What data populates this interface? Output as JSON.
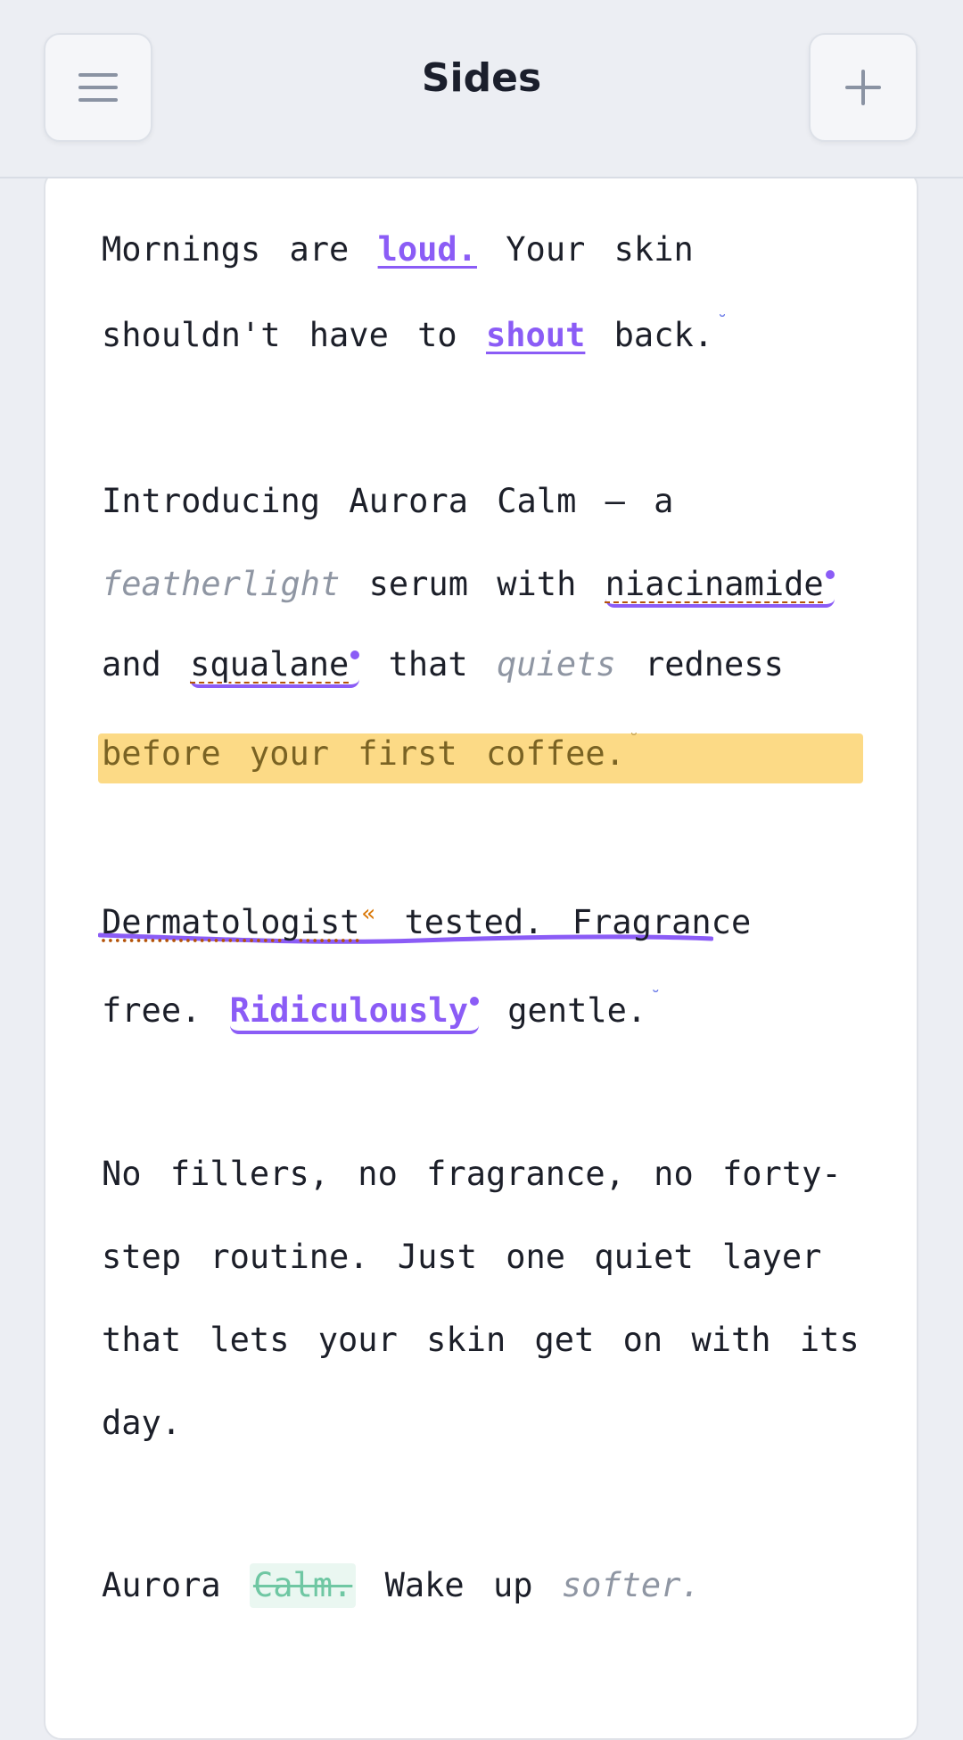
{
  "header": {
    "title": "Sides",
    "menu_icon": "hamburger-menu-icon",
    "add_icon": "plus-icon"
  },
  "copy": {
    "p1": {
      "l1_a": "Mornings are",
      "l1_b": "loud.",
      "l1_c": "Your skin",
      "l2_a": "shouldn't have to",
      "l2_b": "shout",
      "l2_c": "back."
    },
    "p2": {
      "l1": "Introducing Aurora Calm — a",
      "l2_a": "featherlight",
      "l2_b": "serum with",
      "l2_c": "niacinamide",
      "l3_a": "and",
      "l3_b": "squalane",
      "l3_c": "that",
      "l3_d": "quiets",
      "l3_e": "redness",
      "l4": "before your first coffee."
    },
    "p3": {
      "l1_a": "Dermatologist",
      "l1_quote": "«",
      "l1_b": "tested. Fragrance",
      "l2_a": "free.",
      "l2_b": "Ridiculously",
      "l2_c": "gentle."
    },
    "p4": {
      "l1": "No fillers, no fragrance, no forty-",
      "l2": "step routine. Just one quiet layer",
      "l3": "that lets your skin get on with its",
      "l4": "day."
    },
    "p5": {
      "a": "Aurora",
      "b": "Calm.",
      "c": "Wake up",
      "d": "softer."
    }
  },
  "colors": {
    "accent": "#8b5cf6",
    "highlight": "#fcd679",
    "strike": "#6fc7a3",
    "muted": "#8f96a3"
  }
}
